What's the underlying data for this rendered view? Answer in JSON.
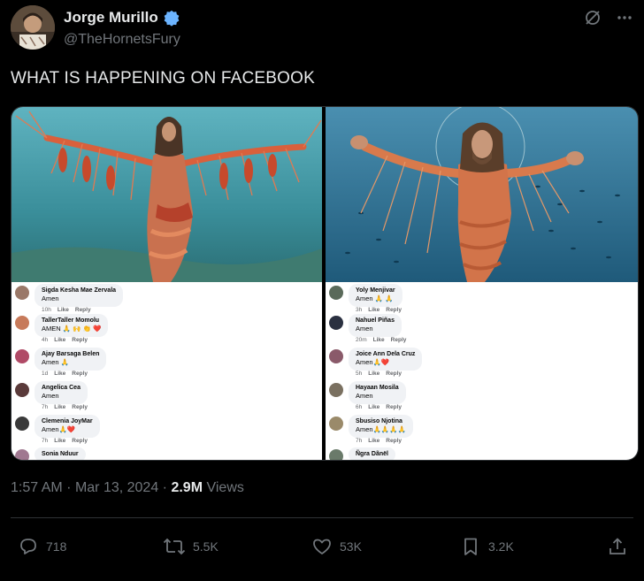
{
  "author": {
    "display_name": "Jorge Murillo",
    "handle": "@TheHornetsFury",
    "verified": true
  },
  "tweet": {
    "text": "WHAT IS HAPPENING ON FACEBOOK"
  },
  "media": {
    "left_comments": [
      {
        "name": "Sigda Kesha Mae Zervala",
        "text": "Amen",
        "time": "10h",
        "like": "Like",
        "reply": "Reply"
      },
      {
        "name": "TallerTaller Momolu",
        "text": "AMEN 🙏 🙌 👏 ❤️",
        "time": "4h",
        "like": "Like",
        "reply": "Reply"
      },
      {
        "name": "Ajay Barsaga Belen",
        "text": "Amen 🙏",
        "time": "1d",
        "like": "Like",
        "reply": "Reply"
      },
      {
        "name": "Angelica Cea",
        "text": "Amen",
        "time": "7h",
        "like": "Like",
        "reply": "Reply"
      },
      {
        "name": "Clemenia JoyMar",
        "text": "Amen🙏❤️",
        "time": "7h",
        "like": "Like",
        "reply": "Reply"
      },
      {
        "name": "Sonia Nduur",
        "text": "",
        "time": "",
        "like": "",
        "reply": ""
      }
    ],
    "right_comments": [
      {
        "name": "Yoly Menjivar",
        "text": "Amen 🙏 🙏",
        "time": "3h",
        "like": "Like",
        "reply": "Reply"
      },
      {
        "name": "Nahuel Piñas",
        "text": "Amen",
        "time": "20m",
        "like": "Like",
        "reply": "Reply"
      },
      {
        "name": "Joice Ann Dela Cruz",
        "text": "Amen🙏❤️",
        "time": "5h",
        "like": "Like",
        "reply": "Reply"
      },
      {
        "name": "Hayaan Mosila",
        "text": "Amen",
        "time": "6h",
        "like": "Like",
        "reply": "Reply"
      },
      {
        "name": "Sbusiso Njotina",
        "text": "Amen🙏🙏🙏🙏",
        "time": "7h",
        "like": "Like",
        "reply": "Reply"
      },
      {
        "name": "Ñgra Dãnël",
        "text": "",
        "time": "",
        "like": "",
        "reply": ""
      }
    ]
  },
  "meta": {
    "time": "1:57 AM",
    "sep1": "·",
    "date": "Mar 13, 2024",
    "sep2": "·",
    "views_count": "2.9M",
    "views_label": "Views"
  },
  "actions": {
    "replies": "718",
    "reposts": "5.5K",
    "likes": "53K",
    "bookmarks": "3.2K"
  },
  "colors": {
    "background": "#000000",
    "text": "#e7e9ea",
    "muted": "#71767b",
    "verified": "#6cb4ff",
    "divider": "#2f3336"
  },
  "icons": [
    "verified-badge-icon",
    "grok-icon",
    "more-icon",
    "reply-icon",
    "repost-icon",
    "like-icon",
    "bookmark-icon",
    "share-icon"
  ]
}
